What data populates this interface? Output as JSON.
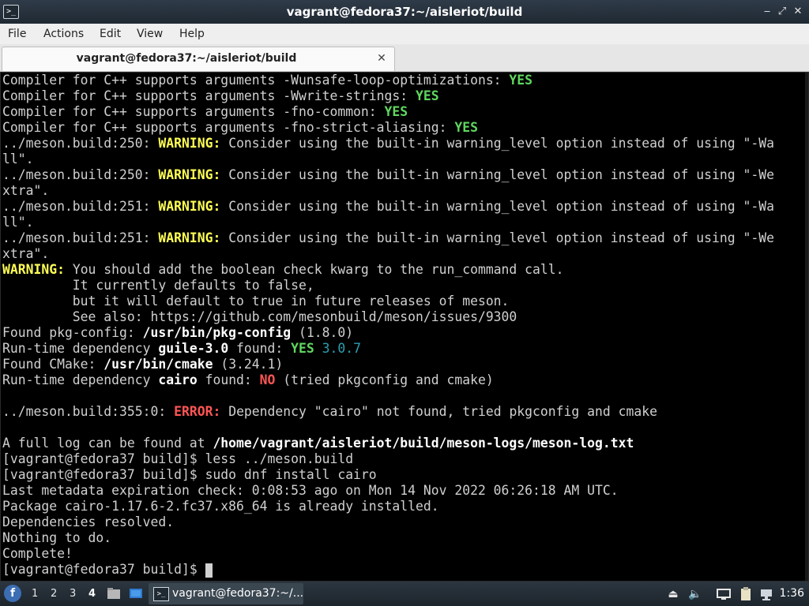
{
  "window": {
    "title": "vagrant@fedora37:~/aisleriot/build",
    "controls": {
      "minimize": "‒",
      "restore": "⤢",
      "close": "✕"
    }
  },
  "menu": [
    "File",
    "Actions",
    "Edit",
    "View",
    "Help"
  ],
  "tab": {
    "label": "vagrant@fedora37:~/aisleriot/build",
    "close": "✕"
  },
  "terminal": {
    "lines": [
      [
        {
          "t": "Compiler for C++ supports arguments -Wunsafe-loop-optimizations: "
        },
        {
          "t": "YES",
          "s": "green"
        }
      ],
      [
        {
          "t": "Compiler for C++ supports arguments -Wwrite-strings: "
        },
        {
          "t": "YES",
          "s": "green"
        }
      ],
      [
        {
          "t": "Compiler for C++ supports arguments -fno-common: "
        },
        {
          "t": "YES",
          "s": "green"
        }
      ],
      [
        {
          "t": "Compiler for C++ supports arguments -fno-strict-aliasing: "
        },
        {
          "t": "YES",
          "s": "green"
        }
      ],
      [
        {
          "t": "../meson.build:250: "
        },
        {
          "t": "WARNING:",
          "s": "yellow"
        },
        {
          "t": " Consider using the built-in warning_level option instead of using \"-Wa"
        }
      ],
      [
        {
          "t": "ll\"."
        }
      ],
      [
        {
          "t": "../meson.build:250: "
        },
        {
          "t": "WARNING:",
          "s": "yellow"
        },
        {
          "t": " Consider using the built-in warning_level option instead of using \"-We"
        }
      ],
      [
        {
          "t": "xtra\"."
        }
      ],
      [
        {
          "t": "../meson.build:251: "
        },
        {
          "t": "WARNING:",
          "s": "yellow"
        },
        {
          "t": " Consider using the built-in warning_level option instead of using \"-Wa"
        }
      ],
      [
        {
          "t": "ll\"."
        }
      ],
      [
        {
          "t": "../meson.build:251: "
        },
        {
          "t": "WARNING:",
          "s": "yellow"
        },
        {
          "t": " Consider using the built-in warning_level option instead of using \"-We"
        }
      ],
      [
        {
          "t": "xtra\"."
        }
      ],
      [
        {
          "t": "WARNING:",
          "s": "yellow"
        },
        {
          "t": " You should add the boolean check kwarg to the run_command call."
        }
      ],
      [
        {
          "t": "         It currently defaults to false,"
        }
      ],
      [
        {
          "t": "         but it will default to true in future releases of meson."
        }
      ],
      [
        {
          "t": "         See also: https://github.com/mesonbuild/meson/issues/9300"
        }
      ],
      [
        {
          "t": "Found pkg-config: "
        },
        {
          "t": "/usr/bin/pkg-config",
          "s": "bold"
        },
        {
          "t": " (1.8.0)"
        }
      ],
      [
        {
          "t": "Run-time dependency "
        },
        {
          "t": "guile-3.0",
          "s": "bold"
        },
        {
          "t": " found: "
        },
        {
          "t": "YES",
          "s": "green"
        },
        {
          "t": " "
        },
        {
          "t": "3.0.7",
          "s": "cyan"
        }
      ],
      [
        {
          "t": "Found CMake: "
        },
        {
          "t": "/usr/bin/cmake",
          "s": "bold"
        },
        {
          "t": " (3.24.1)"
        }
      ],
      [
        {
          "t": "Run-time dependency "
        },
        {
          "t": "cairo",
          "s": "bold"
        },
        {
          "t": " found: "
        },
        {
          "t": "NO",
          "s": "red"
        },
        {
          "t": " (tried pkgconfig and cmake)"
        }
      ],
      [],
      [
        {
          "t": "../meson.build:355:0: "
        },
        {
          "t": "ERROR:",
          "s": "red"
        },
        {
          "t": " Dependency \"cairo\" not found, tried pkgconfig and cmake"
        }
      ],
      [],
      [
        {
          "t": "A full log can be found at "
        },
        {
          "t": "/home/vagrant/aisleriot/build/meson-logs/meson-log.txt",
          "s": "bold"
        }
      ],
      [
        {
          "t": "[vagrant@fedora37 build]$ less ../meson.build"
        }
      ],
      [
        {
          "t": "[vagrant@fedora37 build]$ sudo dnf install cairo"
        }
      ],
      [
        {
          "t": "Last metadata expiration check: 0:08:53 ago on Mon 14 Nov 2022 06:26:18 AM UTC."
        }
      ],
      [
        {
          "t": "Package cairo-1.17.6-2.fc37.x86_64 is already installed."
        }
      ],
      [
        {
          "t": "Dependencies resolved."
        }
      ],
      [
        {
          "t": "Nothing to do."
        }
      ],
      [
        {
          "t": "Complete!"
        }
      ],
      [
        {
          "t": "[vagrant@fedora37 build]$ "
        }
      ]
    ],
    "colors": {
      "green": "#5fd75f",
      "yellow": "#ffff55",
      "red": "#ff5555",
      "cyan": "#2aa1b3"
    }
  },
  "taskbar": {
    "workspaces": [
      "1",
      "2",
      "3",
      "4"
    ],
    "active_workspace": "4",
    "task_label": "vagrant@fedora37:~/...",
    "clock": "1:36",
    "icons": [
      "fedora-logo-icon",
      "file-manager-icon",
      "desktop-icon",
      "terminal-icon",
      "eject-icon",
      "volume-icon",
      "display-icon",
      "clipboard-icon",
      "network-icon"
    ]
  }
}
